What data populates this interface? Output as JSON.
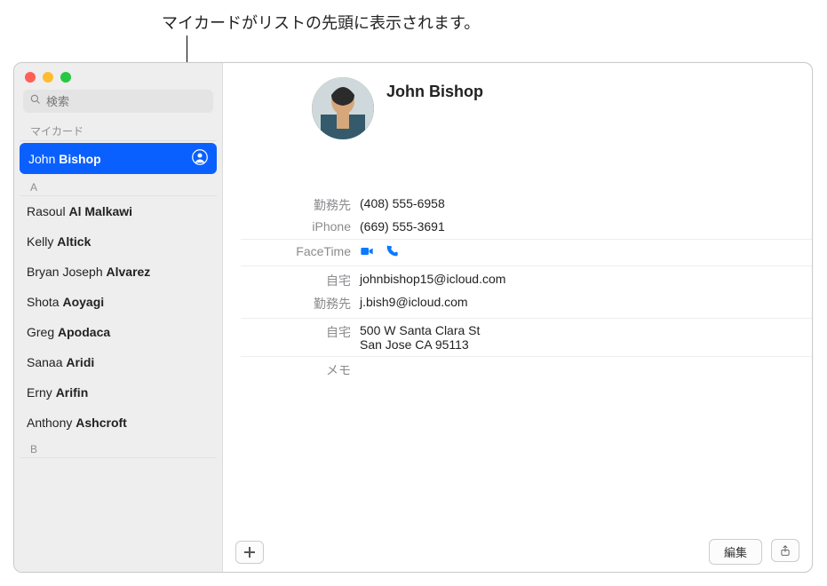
{
  "annotation": "マイカードがリストの先頭に表示されます。",
  "search": {
    "placeholder": "検索"
  },
  "sidebar": {
    "my_card_label": "マイカード",
    "my_card": {
      "first": "John",
      "last": "Bishop"
    },
    "sections": [
      {
        "letter": "A",
        "contacts": [
          {
            "first": "Rasoul",
            "last": "Al Malkawi"
          },
          {
            "first": "Kelly",
            "last": "Altick"
          },
          {
            "first": "Bryan Joseph",
            "last": "Alvarez"
          },
          {
            "first": "Shota",
            "last": "Aoyagi"
          },
          {
            "first": "Greg",
            "last": "Apodaca"
          },
          {
            "first": "Sanaa",
            "last": "Aridi"
          },
          {
            "first": "Erny",
            "last": "Arifin"
          },
          {
            "first": "Anthony",
            "last": "Ashcroft"
          }
        ]
      },
      {
        "letter": "B",
        "contacts": []
      }
    ]
  },
  "detail": {
    "name": "John Bishop",
    "phones": [
      {
        "label": "勤務先",
        "value": "(408) 555-6958"
      },
      {
        "label": "iPhone",
        "value": "(669) 555-3691"
      }
    ],
    "facetime_label": "FaceTime",
    "emails": [
      {
        "label": "自宅",
        "value": "johnbishop15@icloud.com"
      },
      {
        "label": "勤務先",
        "value": "j.bish9@icloud.com"
      }
    ],
    "address": {
      "label": "自宅",
      "line1": "500 W Santa Clara St",
      "line2": "San Jose CA 95113"
    },
    "note_label": "メモ"
  },
  "buttons": {
    "edit": "編集"
  }
}
